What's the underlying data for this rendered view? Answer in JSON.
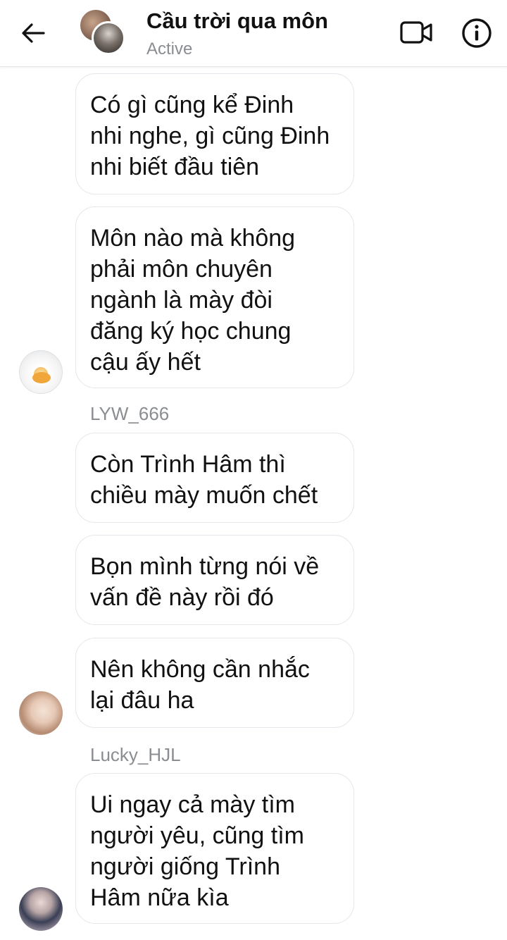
{
  "header": {
    "title": "Cầu trời qua môn",
    "status": "Active",
    "back_icon": "arrow-left-icon",
    "video_icon": "video-camera-icon",
    "info_icon": "info-icon"
  },
  "messages": [
    {
      "text": "Có gì cũng kể Đinh\nnhi nghe, gì cũng Đinh\nnhi biết đầu tiên"
    },
    {
      "text": "Môn nào mà không\nphải môn chuyên\nngành là mày đòi\nđăng ký học chung\ncậu ấy hết"
    },
    {
      "text": "Còn Trình Hâm thì\nchiều mày muốn chết"
    },
    {
      "text": "Bọn mình từng nói về\nvấn đề này rồi đó"
    },
    {
      "text": "Nên không cần nhắc\nlại đâu ha"
    },
    {
      "text": "Ui ngay cả mày tìm\nngười yêu, cũng tìm\nngười giống Trình\nHâm nữa kìa"
    }
  ],
  "senders": [
    "LYW_666",
    "Lucky_HJL"
  ],
  "colors": {
    "bubble_border": "#e4e6eb",
    "secondary_text": "#8a8d91",
    "primary_text": "#111111"
  }
}
